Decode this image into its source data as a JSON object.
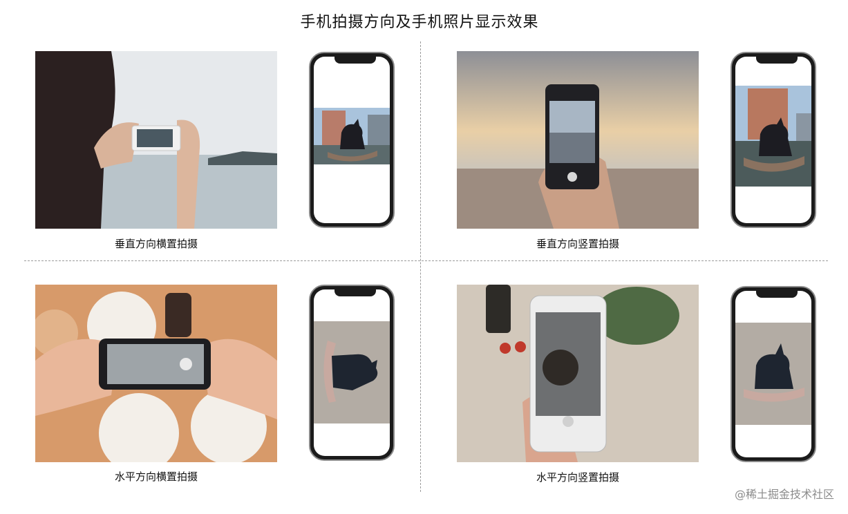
{
  "page": {
    "title": "手机拍摄方向及手机照片显示效果"
  },
  "panels": [
    {
      "caption": "垂直方向横置拍摄"
    },
    {
      "caption": "垂直方向竖置拍摄"
    },
    {
      "caption": "水平方向横置拍摄"
    },
    {
      "caption": "水平方向竖置拍摄"
    }
  ],
  "watermark": "@稀土掘金技术社区",
  "colors": {
    "divider": "#9a9a9a",
    "phone_body": "#1b1b1b",
    "phone_rim": "#8a8a8a",
    "watermark": "#8b8b8b"
  }
}
